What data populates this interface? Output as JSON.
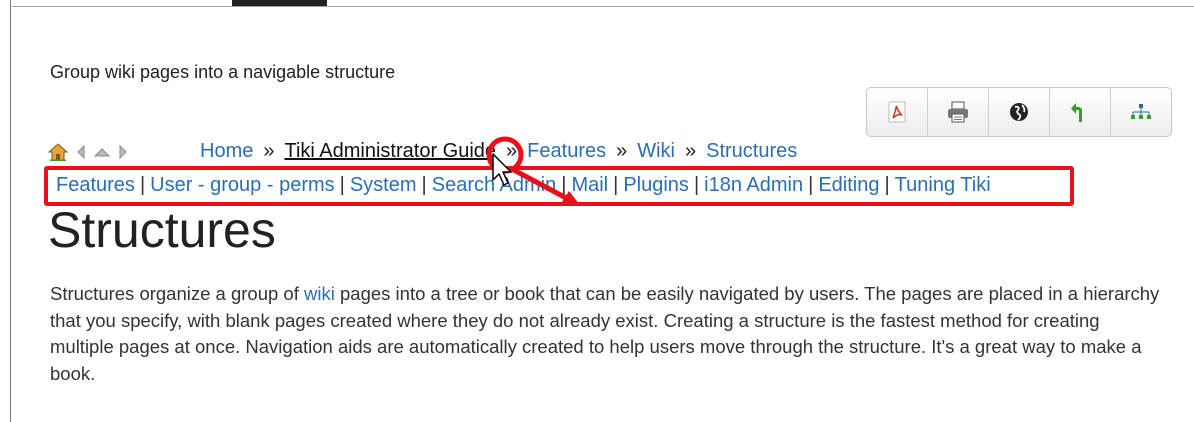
{
  "page": {
    "description": "Group wiki pages into a navigable structure",
    "heading": "Structures"
  },
  "toolbar": {
    "buttons": [
      {
        "name": "pdf-icon",
        "color": "#d0392b"
      },
      {
        "name": "print-icon",
        "color": "#555555"
      },
      {
        "name": "globe-icon",
        "color": "#222222"
      },
      {
        "name": "back-arrow-icon",
        "color": "#3a9a2a"
      },
      {
        "name": "structure-icon",
        "color": "#2d6a8a"
      }
    ]
  },
  "navicons": [
    "home-icon",
    "previous-icon",
    "parent-icon",
    "next-icon"
  ],
  "breadcrumb": {
    "items": [
      "Home",
      "Tiki Administrator Guide",
      "Features",
      "Wiki",
      "Structures"
    ],
    "separator": "»"
  },
  "menubar": {
    "items": [
      "Features",
      "User - group - perms",
      "System",
      "Search Admin",
      "Mail",
      "Plugins",
      "i18n Admin",
      "Editing",
      "Tuning Tiki"
    ],
    "separator": "|"
  },
  "paragraph": {
    "before_link": "Structures organize a group of ",
    "link": "wiki",
    "after_link": " pages into a tree or book that can be easily navigated by users. The pages are placed in a hierarchy that you specify, with blank pages created where they do not already exist. Creating a structure is the fastest method for creating multiple pages at once. Navigation aids are automatically created to help users move through the structure. It's a great way to make a book."
  },
  "colors": {
    "link": "#2a6fb5",
    "highlight": "#e8101a"
  }
}
